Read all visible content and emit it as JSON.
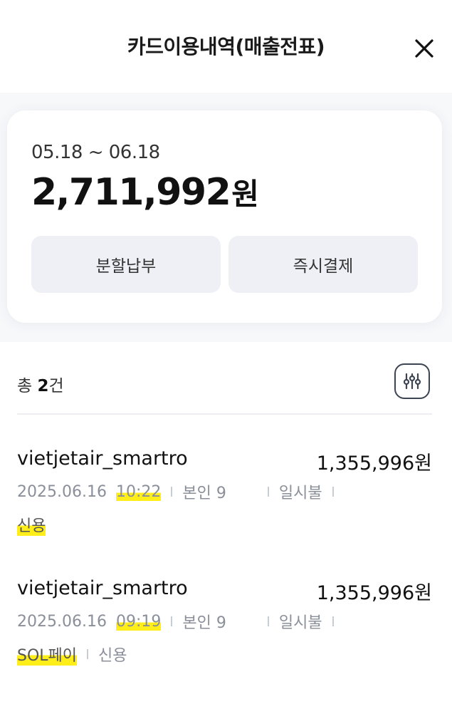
{
  "header": {
    "title": "카드이용내역(매출전표)",
    "close_icon": "close-icon"
  },
  "summary": {
    "period": "05.18 ~ 06.18",
    "total_amount": "2,711,992",
    "total_unit": "원",
    "buttons": {
      "installment": "분할납부",
      "instant_pay": "즉시결제"
    }
  },
  "list": {
    "count_prefix": "총 ",
    "count_value": "2",
    "count_suffix": "건",
    "filter_icon": "filter-sliders-icon"
  },
  "transactions": [
    {
      "merchant": "vietjetair_smartro",
      "amount": "1,355,996원",
      "date": "2025.06.16",
      "time": "10:22",
      "owner": "본인 9",
      "payment_type": "일시불",
      "tags": [
        "신용"
      ]
    },
    {
      "merchant": "vietjetair_smartro",
      "amount": "1,355,996원",
      "date": "2025.06.16",
      "time": "09:19",
      "owner": "본인 9",
      "payment_type": "일시불",
      "tags": [
        "SOL페이",
        "신용"
      ]
    }
  ],
  "colors": {
    "background": "#ffffff",
    "band": "#f7f8fa",
    "button_bg": "#eef0f5",
    "highlight": "#ffec00",
    "meta_text": "#8a8f99"
  }
}
